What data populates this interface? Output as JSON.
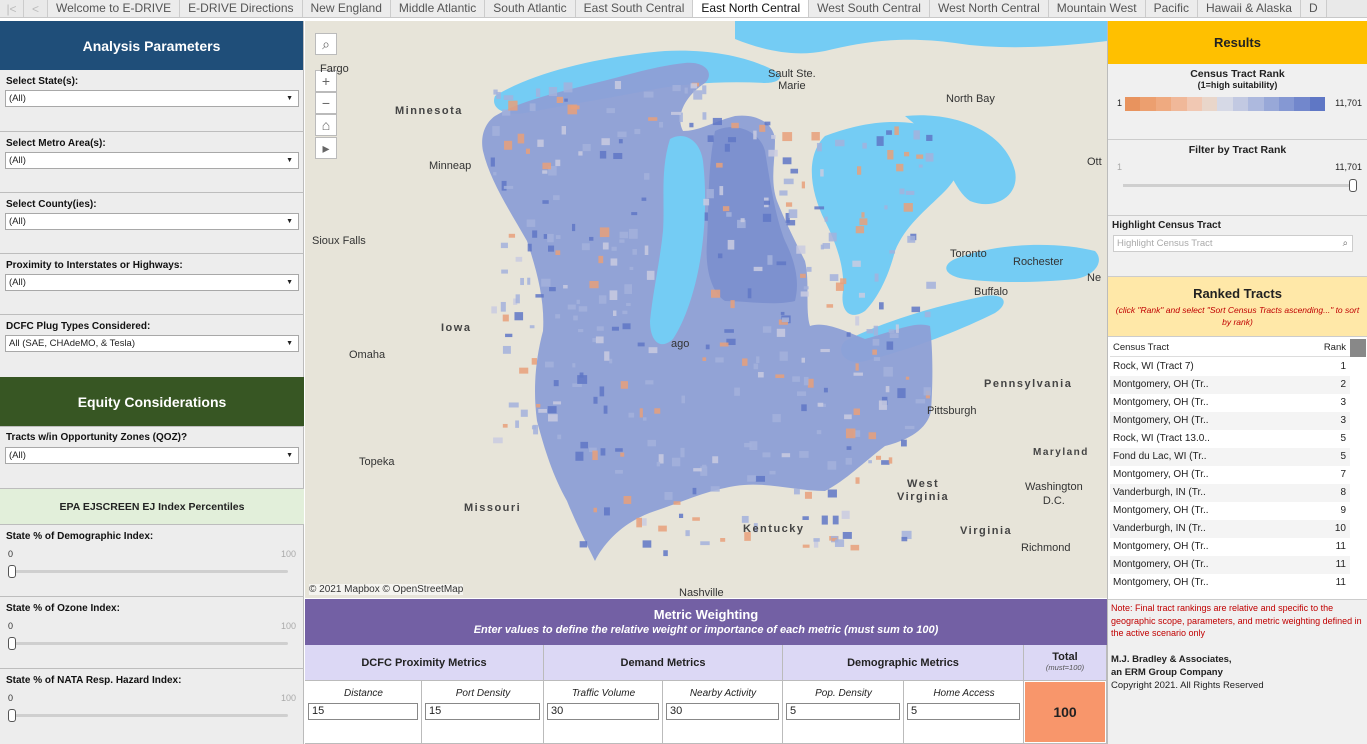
{
  "tabs": [
    "Welcome to E-DRIVE",
    "E-DRIVE Directions",
    "New England",
    "Middle Atlantic",
    "South Atlantic",
    "East South Central",
    "East North Central",
    "West South Central",
    "West North Central",
    "Mountain West",
    "Pacific",
    "Hawaii & Alaska",
    "D"
  ],
  "active_tab": "East North Central",
  "analysis": {
    "title": "Analysis Parameters",
    "fields": [
      {
        "label": "Select State(s):",
        "value": "(All)"
      },
      {
        "label": "Select Metro Area(s):",
        "value": "(All)"
      },
      {
        "label": "Select County(ies):",
        "value": "(All)"
      },
      {
        "label": "Proximity to Interstates or Highways:",
        "value": "(All)"
      },
      {
        "label": "DCFC Plug Types Considered:",
        "value": "All (SAE, CHAdeMO, & Tesla)"
      }
    ]
  },
  "equity": {
    "title": "Equity Considerations",
    "qoz_label": "Tracts w/in Opportunity Zones (QOZ)?",
    "qoz_value": "(All)",
    "ej_title": "EPA EJSCREEN EJ Index Percentiles",
    "sliders": [
      {
        "label": "State % of Demographic Index:",
        "min": "0",
        "max": "100",
        "value": 0
      },
      {
        "label": "State % of Ozone Index:",
        "min": "0",
        "max": "100",
        "value": 0
      },
      {
        "label": "State % of NATA Resp. Hazard Index:",
        "min": "0",
        "max": "100",
        "value": 0
      }
    ]
  },
  "map": {
    "attribution": "© 2021 Mapbox © OpenStreetMap",
    "cities": [
      {
        "name": "Fargo"
      },
      {
        "name": "Minneap"
      },
      {
        "name": "Sioux Falls"
      },
      {
        "name": "Omaha"
      },
      {
        "name": "Topeka"
      },
      {
        "name": "Sault Ste.\nMarie"
      },
      {
        "name": "North Bay"
      },
      {
        "name": "Ott"
      },
      {
        "name": "Toronto"
      },
      {
        "name": "Rochester"
      },
      {
        "name": "Buffalo"
      },
      {
        "name": "Ne"
      },
      {
        "name": "Pittsburgh"
      },
      {
        "name": "Washington\nD.C."
      },
      {
        "name": "Richmond"
      },
      {
        "name": "Nashville"
      },
      {
        "name": "ago"
      }
    ],
    "states": [
      "Minnesota",
      "Iowa",
      "Missouri",
      "Kentucky",
      "Pennsylvania",
      "West\nVirginia",
      "Virginia",
      "Maryland"
    ]
  },
  "results": {
    "title": "Results",
    "legend_title": "Census Tract Rank",
    "legend_sub": "(1=high suitability)",
    "legend_min": "1",
    "legend_max": "11,701",
    "legend_colors": [
      "#e8935e",
      "#ec9f6f",
      "#efaa80",
      "#f0b899",
      "#f1c8b3",
      "#e9d6ca",
      "#d6d9e6",
      "#c2c9e2",
      "#adb9de",
      "#98a8d8",
      "#8598d3",
      "#7287cc",
      "#5f77c5"
    ],
    "filter_title": "Filter by Tract Rank",
    "filter_min": "1",
    "filter_max": "11,701",
    "highlight_title": "Highlight Census Tract",
    "highlight_placeholder": "Highlight Census Tract",
    "ranked_title": "Ranked Tracts",
    "ranked_note": "(click \"Rank\" and select \"Sort Census Tracts ascending...\" to sort by rank)",
    "col_tract": "Census Tract",
    "col_rank": "Rank",
    "rows": [
      {
        "tract": "Rock, WI (Tract 7)",
        "rank": "1"
      },
      {
        "tract": "Montgomery, OH (Tr..",
        "rank": "2"
      },
      {
        "tract": "Montgomery, OH (Tr..",
        "rank": "3"
      },
      {
        "tract": "Montgomery, OH (Tr..",
        "rank": "3"
      },
      {
        "tract": "Rock, WI (Tract 13.0..",
        "rank": "5"
      },
      {
        "tract": "Fond du Lac, WI (Tr..",
        "rank": "5"
      },
      {
        "tract": "Montgomery, OH (Tr..",
        "rank": "7"
      },
      {
        "tract": "Vanderburgh, IN (Tr..",
        "rank": "8"
      },
      {
        "tract": "Montgomery, OH (Tr..",
        "rank": "9"
      },
      {
        "tract": "Vanderburgh, IN (Tr..",
        "rank": "10"
      },
      {
        "tract": "Montgomery, OH (Tr..",
        "rank": "11"
      },
      {
        "tract": "Montgomery, OH (Tr..",
        "rank": "11"
      },
      {
        "tract": "Montgomery, OH (Tr..",
        "rank": "11"
      }
    ],
    "note": "Note:  Final tract rankings are relative and specific to the geographic scope, parameters, and metric weighting defined in the active scenario only",
    "company1": "M.J. Bradley & Associates,",
    "company2": "an ERM Group Company",
    "copyright": "Copyright 2021.  All Rights Reserved"
  },
  "metric": {
    "title": "Metric Weighting",
    "subtitle": "Enter values to define the relative weight or importance of each metric (must sum to 100)",
    "groups": [
      "DCFC Proximity Metrics",
      "Demand Metrics",
      "Demographic Metrics"
    ],
    "total_label": "Total",
    "total_sub": "(must=100)",
    "total_value": "100",
    "metrics": [
      {
        "label": "Distance",
        "value": "15"
      },
      {
        "label": "Port Density",
        "value": "15"
      },
      {
        "label": "Traffic Volume",
        "value": "30"
      },
      {
        "label": "Nearby Activity",
        "value": "30"
      },
      {
        "label": "Pop. Density",
        "value": "5"
      },
      {
        "label": "Home Access",
        "value": "5"
      }
    ]
  },
  "colors": {
    "analysis_header": "#1f4e79",
    "equity_header": "#375623",
    "results_header": "#ffc000",
    "metric_header": "#7360a4",
    "metric_group": "#dcd8f5",
    "total_cell": "#f8966b",
    "ranked_header": "#ffe8a8",
    "note_text": "#c00000",
    "water": "#74ccf4",
    "land": "#e7e4d9"
  }
}
